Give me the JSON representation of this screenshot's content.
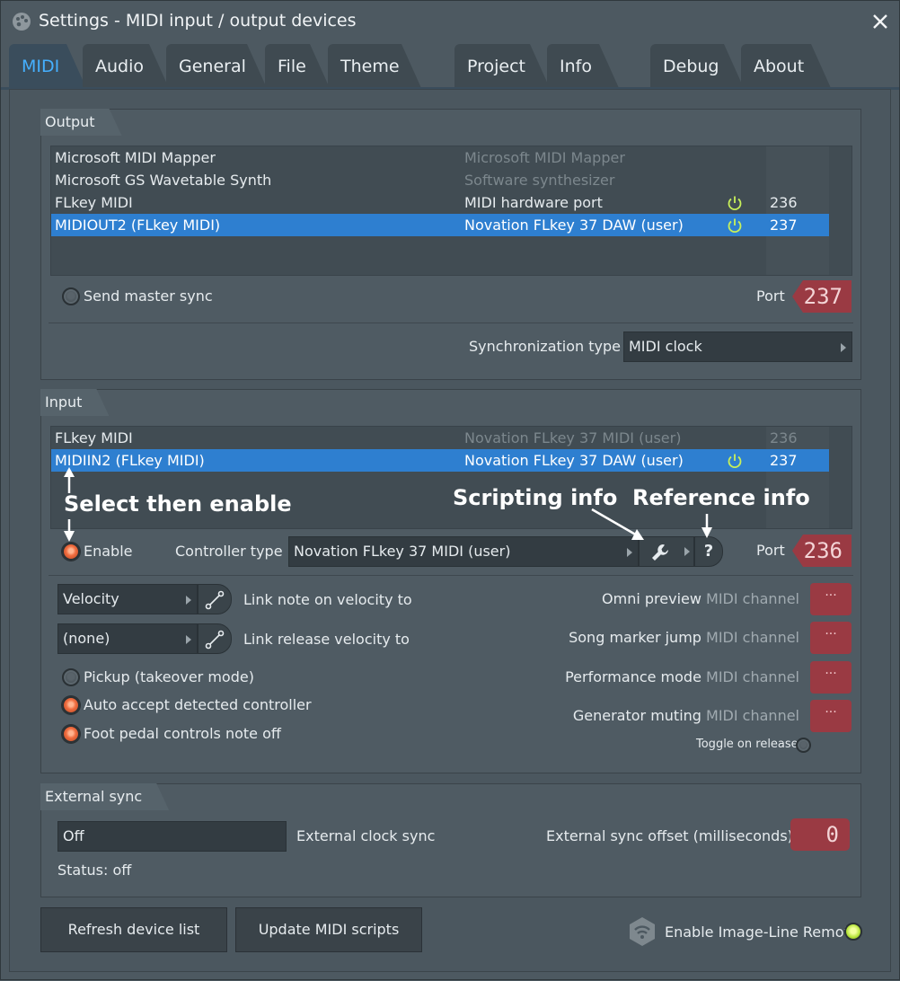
{
  "window": {
    "title": "Settings - MIDI input / output devices"
  },
  "tabs": [
    "MIDI",
    "Audio",
    "General",
    "File",
    "Theme",
    "Project",
    "Info",
    "Debug",
    "About"
  ],
  "output": {
    "section_title": "Output",
    "devices": [
      {
        "name": "Microsoft MIDI Mapper",
        "type": "Microsoft MIDI Mapper",
        "enabled": false,
        "port": ""
      },
      {
        "name": "Microsoft GS Wavetable Synth",
        "type": "Software synthesizer",
        "enabled": false,
        "port": ""
      },
      {
        "name": "FLkey MIDI",
        "type": "MIDI hardware port",
        "enabled": true,
        "port": "236"
      },
      {
        "name": "MIDIOUT2 (FLkey MIDI)",
        "type": "Novation FLkey 37 DAW (user)",
        "enabled": true,
        "port": "237"
      }
    ],
    "send_master_sync_label": "Send master sync",
    "port_label": "Port",
    "port_value": "237",
    "sync_type_label": "Synchronization type",
    "sync_type_value": "MIDI clock"
  },
  "input": {
    "section_title": "Input",
    "devices": [
      {
        "name": "FLkey MIDI",
        "type": "Novation FLkey 37 MIDI (user)",
        "enabled": false,
        "port": "236"
      },
      {
        "name": "MIDIIN2 (FLkey MIDI)",
        "type": "Novation FLkey 37 DAW (user)",
        "enabled": true,
        "port": "237"
      }
    ],
    "enable_label": "Enable",
    "controller_type_label": "Controller type",
    "controller_type_value": "Novation FLkey 37 MIDI (user)",
    "port_label": "Port",
    "port_value": "236",
    "velocity_value": "Velocity",
    "link_note_label": "Link note on velocity to",
    "release_value": "(none)",
    "link_release_label": "Link release velocity to",
    "pickup_label": "Pickup (takeover mode)",
    "auto_accept_label": "Auto accept detected controller",
    "foot_pedal_label": "Foot pedal controls note off",
    "omni_label": "Omni preview",
    "song_marker_label": "Song marker jump",
    "performance_label": "Performance mode",
    "generator_label": "Generator muting",
    "midi_channel_label": "MIDI channel",
    "channel_value": "···",
    "toggle_release_label": "Toggle on release"
  },
  "external_sync": {
    "section_title": "External sync",
    "clock_value": "Off",
    "clock_label": "External clock sync",
    "offset_label": "External sync offset (milliseconds)",
    "offset_value": "0",
    "status": "Status: off"
  },
  "footer": {
    "refresh_label": "Refresh device list",
    "update_label": "Update MIDI scripts",
    "remote_label": "Enable Image-Line Remote"
  },
  "annotations": {
    "select_enable": "Select then enable",
    "scripting": "Scripting info",
    "reference": "Reference info"
  },
  "colors": {
    "accent": "#45b0ff",
    "selection": "#2e7fd0",
    "port_box": "#9a3a43",
    "power_on": "#c7ef5a",
    "led_on": "#ef6a3c"
  }
}
